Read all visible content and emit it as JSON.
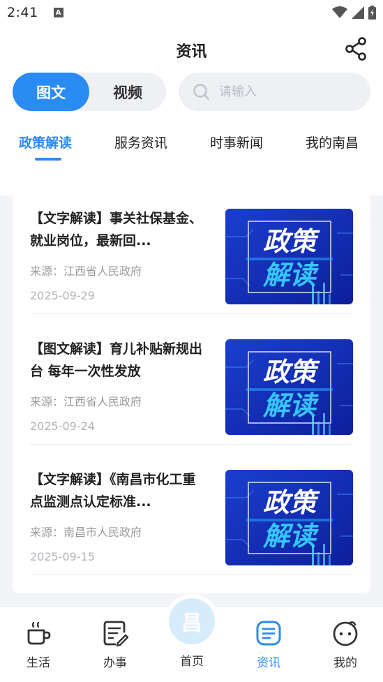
{
  "status_bar": {
    "time": "2:41",
    "badge": "A"
  },
  "header": {
    "title": "资讯",
    "segments": [
      {
        "label": "图文",
        "active": true
      },
      {
        "label": "视频",
        "active": false
      }
    ],
    "search": {
      "placeholder": "请输入",
      "value": ""
    }
  },
  "categories": [
    {
      "label": "政策解读",
      "active": true
    },
    {
      "label": "服务资讯",
      "active": false
    },
    {
      "label": "时事新闻",
      "active": false
    },
    {
      "label": "我的南昌",
      "active": false
    }
  ],
  "articles": [
    {
      "title": "【文字解读】事关社保基金、就业岗位，最新回...",
      "source": "来源：江西省人民政府",
      "date": "2025-09-29",
      "thumb_text_1": "政策",
      "thumb_text_2": "解读"
    },
    {
      "title": "【图文解读】育儿补贴新规出台 每年一次性发放",
      "source": "来源：江西省人民政府",
      "date": "2025-09-24",
      "thumb_text_1": "政策",
      "thumb_text_2": "解读"
    },
    {
      "title": "【文字解读】《南昌市化工重点监测点认定标准...",
      "source": "来源：南昌市人民政府",
      "date": "2025-09-15",
      "thumb_text_1": "政策",
      "thumb_text_2": "解读"
    }
  ],
  "bottom_nav": [
    {
      "label": "生活",
      "icon": "coffee-cup-icon",
      "active": false
    },
    {
      "label": "办事",
      "icon": "notepad-pen-icon",
      "active": false
    },
    {
      "label": "首页",
      "icon": "home-logo-icon",
      "active": false,
      "logo_char": "昌"
    },
    {
      "label": "资讯",
      "icon": "document-list-icon",
      "active": true
    },
    {
      "label": "我的",
      "icon": "smiley-face-icon",
      "active": false
    }
  ],
  "colors": {
    "accent": "#2a8bf2",
    "background": "#f2f4f7"
  }
}
